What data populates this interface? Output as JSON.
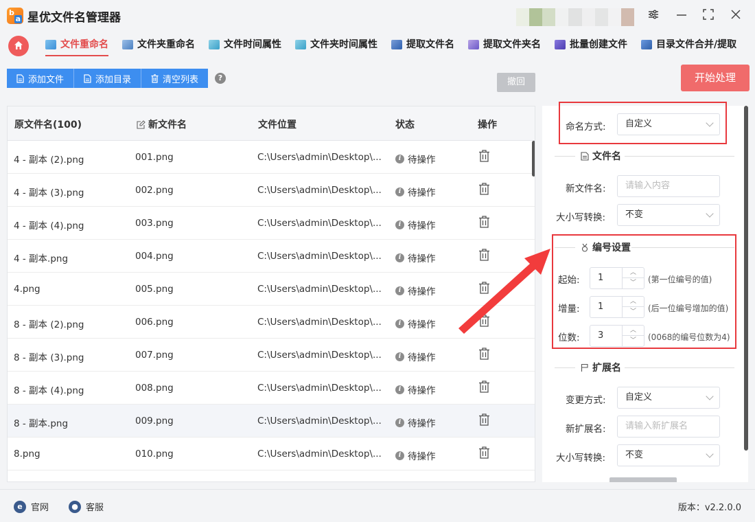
{
  "app": {
    "title": "星优文件名管理器",
    "logo_letters": [
      "b",
      "a"
    ]
  },
  "window_controls": [
    "settings-icon",
    "minimize-icon",
    "maximize-icon",
    "close-icon"
  ],
  "tabs": [
    {
      "label": "文件重命名",
      "active": true
    },
    {
      "label": "文件夹重命名",
      "active": false
    },
    {
      "label": "文件时间属性",
      "active": false
    },
    {
      "label": "文件夹时间属性",
      "active": false
    },
    {
      "label": "提取文件名",
      "active": false
    },
    {
      "label": "提取文件夹名",
      "active": false
    },
    {
      "label": "批量创建文件",
      "active": false
    },
    {
      "label": "目录文件合并/提取",
      "active": false
    }
  ],
  "toolbar": {
    "add_file": "添加文件",
    "add_dir": "添加目录",
    "clear_list": "清空列表",
    "help": "?",
    "undo": "撤回",
    "start": "开始处理"
  },
  "table": {
    "headers": {
      "original": "原文件名(100)",
      "new_name": "新文件名",
      "location": "文件位置",
      "status": "状态",
      "action": "操作"
    },
    "rows": [
      {
        "original": "4 - 副本 (2).png",
        "new_name": "001.png",
        "location": "C:\\Users\\admin\\Desktop\\...",
        "status": "待操作"
      },
      {
        "original": "4 - 副本 (3).png",
        "new_name": "002.png",
        "location": "C:\\Users\\admin\\Desktop\\...",
        "status": "待操作"
      },
      {
        "original": "4 - 副本 (4).png",
        "new_name": "003.png",
        "location": "C:\\Users\\admin\\Desktop\\...",
        "status": "待操作"
      },
      {
        "original": "4 - 副本.png",
        "new_name": "004.png",
        "location": "C:\\Users\\admin\\Desktop\\...",
        "status": "待操作"
      },
      {
        "original": "4.png",
        "new_name": "005.png",
        "location": "C:\\Users\\admin\\Desktop\\...",
        "status": "待操作"
      },
      {
        "original": "8 - 副本 (2).png",
        "new_name": "006.png",
        "location": "C:\\Users\\admin\\Desktop\\...",
        "status": "待操作"
      },
      {
        "original": "8 - 副本 (3).png",
        "new_name": "007.png",
        "location": "C:\\Users\\admin\\Desktop\\...",
        "status": "待操作"
      },
      {
        "original": "8 - 副本 (4).png",
        "new_name": "008.png",
        "location": "C:\\Users\\admin\\Desktop\\...",
        "status": "待操作"
      },
      {
        "original": "8 - 副本.png",
        "new_name": "009.png",
        "location": "C:\\Users\\admin\\Desktop\\...",
        "status": "待操作"
      },
      {
        "original": "8.png",
        "new_name": "010.png",
        "location": "C:\\Users\\admin\\Desktop\\...",
        "status": "待操作"
      }
    ],
    "highlighted_row": 8
  },
  "settings": {
    "naming_mode_label": "命名方式:",
    "naming_mode_value": "自定义",
    "filename_section": "文件名",
    "new_name_label": "新文件名:",
    "new_name_placeholder": "请输入内容",
    "case_label": "大小写转换:",
    "case_value": "不变",
    "numbering_section": "编号设置",
    "start_label": "起始:",
    "start_value": "1",
    "start_hint": "(第一位编号的值)",
    "step_label": "增量:",
    "step_value": "1",
    "step_hint": "(后一位编号增加的值)",
    "digits_label": "位数:",
    "digits_value": "3",
    "digits_hint": "(0068的编号位数为4)",
    "ext_section": "扩展名",
    "ext_mode_label": "变更方式:",
    "ext_mode_value": "自定义",
    "new_ext_label": "新扩展名:",
    "new_ext_placeholder": "请输入新扩展名",
    "ext_case_label": "大小写转换:",
    "ext_case_value": "不变"
  },
  "footer": {
    "website": "官网",
    "support": "客服",
    "version": "版本：v2.2.0.0"
  },
  "colors": {
    "accent_red": "#e34c4c",
    "primary_blue": "#3d8ef0",
    "start_button": "#f06b6b",
    "annotation_red": "#e8383d"
  }
}
